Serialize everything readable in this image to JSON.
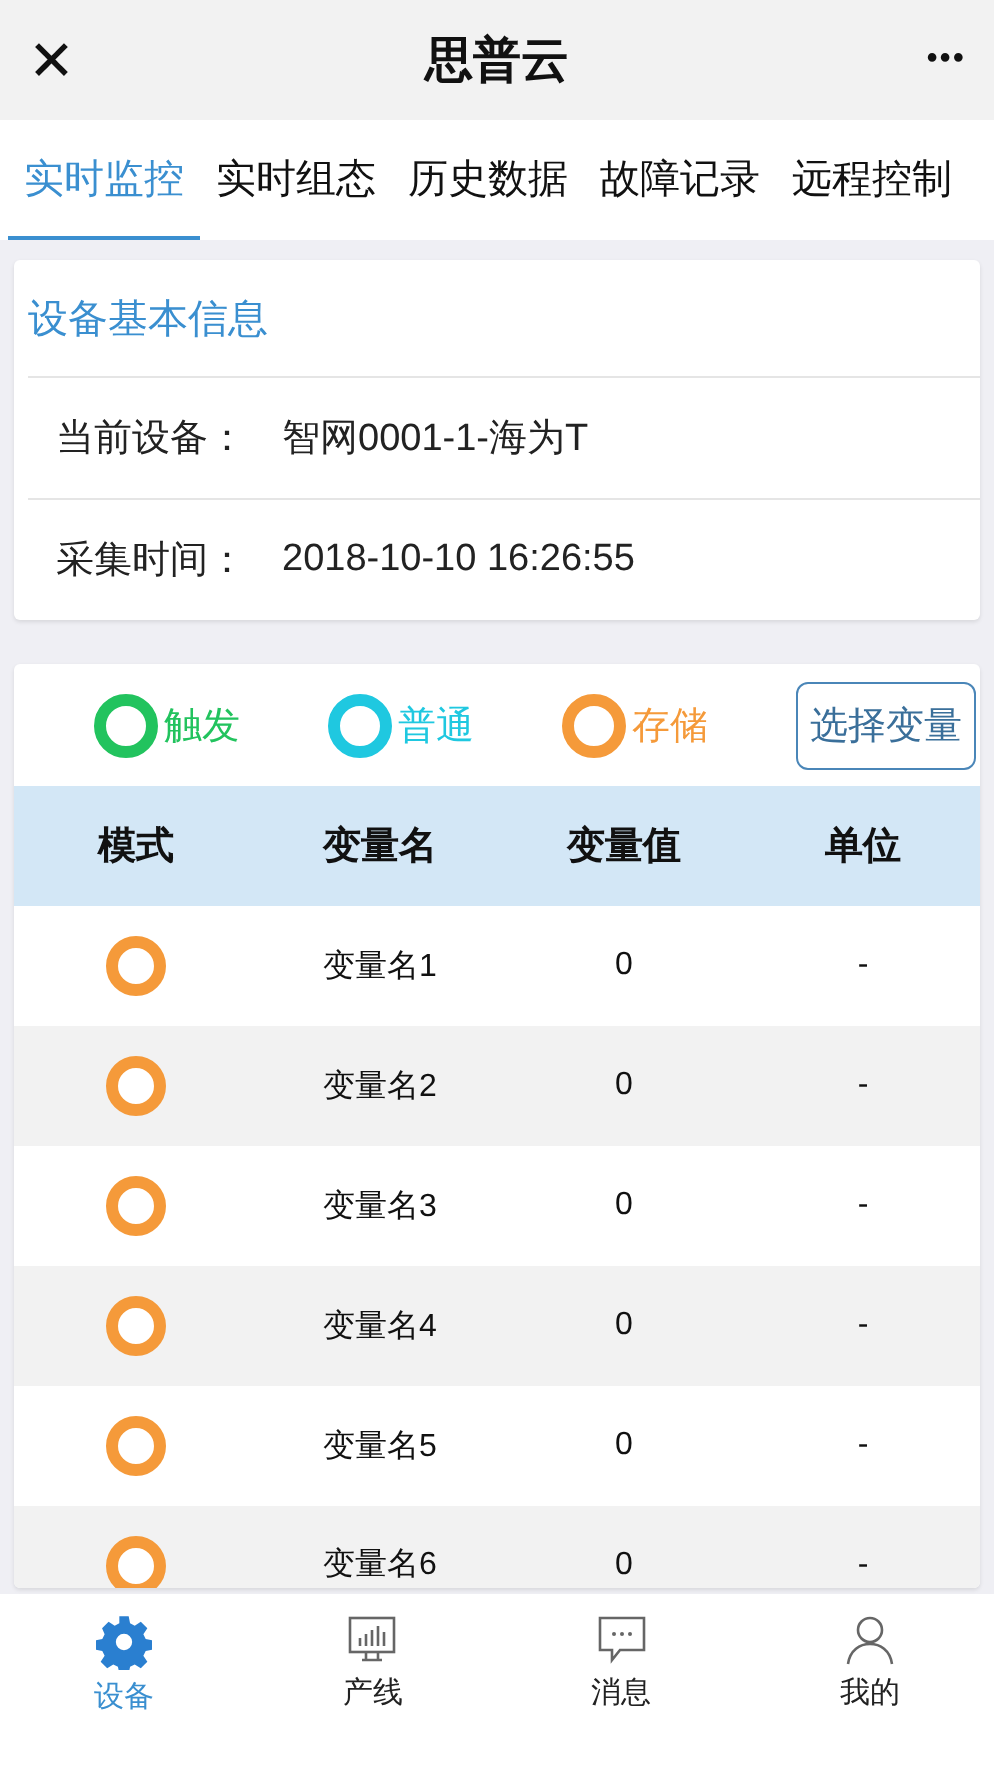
{
  "header": {
    "close": "✕",
    "title": "思普云",
    "more": "•••"
  },
  "tabs": [
    {
      "label": "实时监控",
      "selected": true
    },
    {
      "label": "实时组态",
      "selected": false
    },
    {
      "label": "历史数据",
      "selected": false
    },
    {
      "label": "故障记录",
      "selected": false
    },
    {
      "label": "远程控制",
      "selected": false
    }
  ],
  "info": {
    "title": "设备基本信息",
    "fields": [
      {
        "label": "当前设备：",
        "value": "智网0001-1-海为T"
      },
      {
        "label": "采集时间：",
        "value": "2018-10-10 16:26:55"
      }
    ]
  },
  "legend": [
    {
      "label": "触发",
      "color": "#22c35e"
    },
    {
      "label": "普通",
      "color": "#1fc8e0"
    },
    {
      "label": "存储",
      "color": "#f59a3a"
    }
  ],
  "select_button": "选择变量",
  "table": {
    "columns": [
      "模式",
      "变量名",
      "变量值",
      "单位"
    ],
    "rows": [
      {
        "color": "#f59a3a",
        "name": "变量名1",
        "value": "0",
        "unit": "-"
      },
      {
        "color": "#f59a3a",
        "name": "变量名2",
        "value": "0",
        "unit": "-"
      },
      {
        "color": "#f59a3a",
        "name": "变量名3",
        "value": "0",
        "unit": "-"
      },
      {
        "color": "#f59a3a",
        "name": "变量名4",
        "value": "0",
        "unit": "-"
      },
      {
        "color": "#f59a3a",
        "name": "变量名5",
        "value": "0",
        "unit": "-"
      },
      {
        "color": "#f59a3a",
        "name": "变量名6",
        "value": "0",
        "unit": "-"
      }
    ]
  },
  "nav": [
    {
      "kind": "gear",
      "label": "设备",
      "selected": true
    },
    {
      "kind": "chart",
      "label": "产线",
      "selected": false
    },
    {
      "kind": "chat",
      "label": "消息",
      "selected": false
    },
    {
      "kind": "person",
      "label": "我的",
      "selected": false
    }
  ]
}
